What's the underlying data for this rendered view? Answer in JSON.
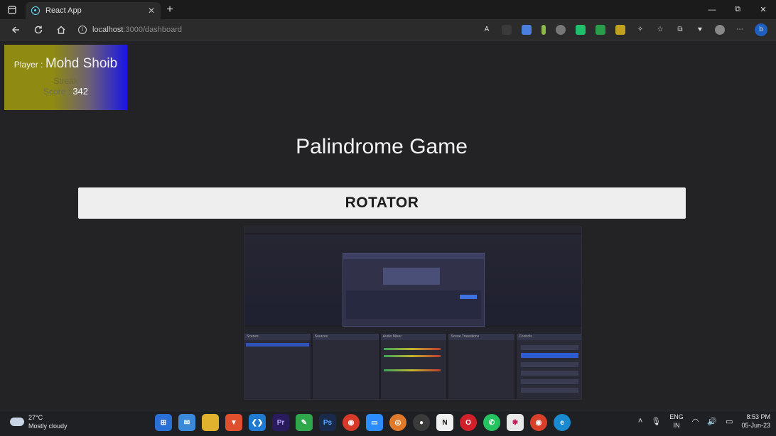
{
  "browser": {
    "tab_title": "React App",
    "tab_close": "✕",
    "new_tab": "+",
    "url_host": "localhost",
    "url_rest": ":3000/dashboard",
    "window_controls": {
      "minimize": "—",
      "restore": "⧉",
      "close": "✕"
    }
  },
  "player": {
    "label": "Player :",
    "name": "Mohd Shoib",
    "streak_label": "Streak",
    "streak_value": "",
    "score_label": "Score :",
    "score_value": "342"
  },
  "game": {
    "title": "Palindrome Game",
    "word": "ROTATOR"
  },
  "preview": {
    "docks": [
      "Scenes",
      "Sources",
      "Audio Mixer",
      "Scene Transitions",
      "Controls"
    ]
  },
  "taskbar": {
    "temperature": "27°C",
    "weather_desc": "Mostly cloudy",
    "lang_top": "ENG",
    "lang_bottom": "IN",
    "time": "8:53 PM",
    "date": "05-Jun-23"
  }
}
